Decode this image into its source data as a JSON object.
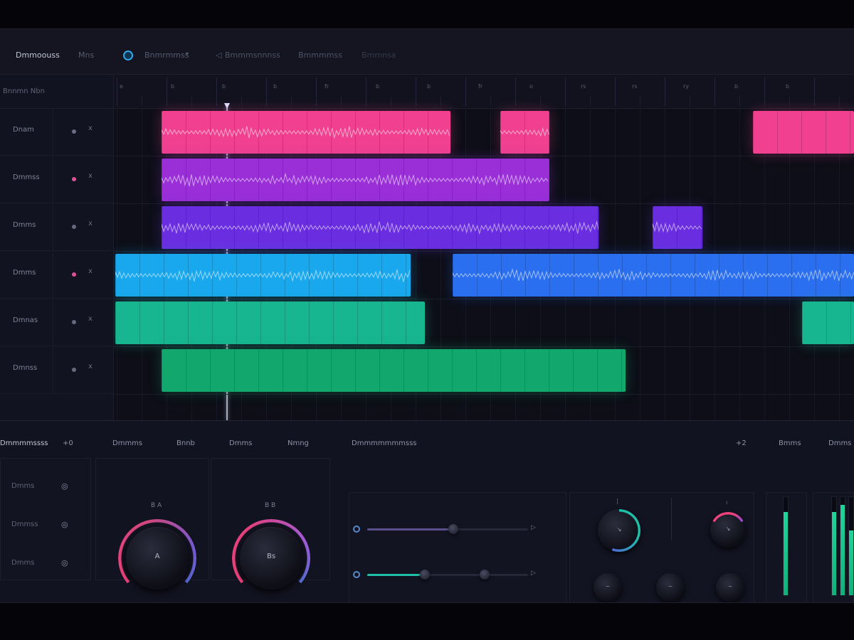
{
  "toolbar": {
    "title": "Dmmoouss",
    "menu_item": "Mns",
    "dropdown_label": "Bnmrmmss",
    "back_label": "Bmmmsnnnss",
    "item_3": "Bmmmmss",
    "item_4": "Bmmnsa"
  },
  "header": {
    "label": "Bnnmn Nbn"
  },
  "ruler_labels": [
    "e",
    "b",
    "b",
    "b",
    "fr",
    "b",
    "b",
    "fr",
    "o",
    "rs",
    "rs",
    "ry",
    "b",
    "b"
  ],
  "tracks": [
    {
      "name": "Dnam",
      "indicator": "#6b6e82",
      "mark": "x"
    },
    {
      "name": "Dmmss",
      "indicator": "#e0509a",
      "mark": "x"
    },
    {
      "name": "Dmms",
      "indicator": "#676a7e",
      "mark": "x"
    },
    {
      "name": "Dmms",
      "indicator": "#e0509a",
      "mark": "x"
    },
    {
      "name": "Dmnas",
      "indicator": "#676a7e",
      "mark": "x"
    },
    {
      "name": "Dmnss",
      "indicator": "#676a7e",
      "mark": "x"
    }
  ],
  "colors": {
    "pink": "#f0408f",
    "magenta": "#9a2fd8",
    "violet": "#6a2ee0",
    "cyan": "#19a8ee",
    "blue": "#2a6ff0",
    "indigo": "#3540e8",
    "teal": "#17b590",
    "green": "#12a86d",
    "accent_teal": "#1fbfa8",
    "accent_pink": "#f2437d"
  },
  "clips": [
    {
      "lane": 0,
      "color": "pink",
      "start": 0.064,
      "end": 0.455,
      "wave": true
    },
    {
      "lane": 0,
      "color": "pink",
      "start": 0.522,
      "end": 0.588,
      "wave": true
    },
    {
      "lane": 0,
      "color": "pink",
      "start": 0.863,
      "end": 1.0,
      "wave": false
    },
    {
      "lane": 1,
      "color": "magenta",
      "start": 0.064,
      "end": 0.588,
      "wave": true
    },
    {
      "lane": 2,
      "color": "violet",
      "start": 0.064,
      "end": 0.655,
      "wave": true
    },
    {
      "lane": 2,
      "color": "violet",
      "start": 0.728,
      "end": 0.795,
      "wave": true
    },
    {
      "lane": 3,
      "color": "cyan",
      "start": 0.002,
      "end": 0.401,
      "wave": true
    },
    {
      "lane": 3,
      "color": "blue",
      "start": 0.458,
      "end": 1.0,
      "wave": true
    },
    {
      "lane": 4,
      "color": "teal",
      "start": 0.002,
      "end": 0.42,
      "wave": false
    },
    {
      "lane": 4,
      "color": "teal",
      "start": 0.93,
      "end": 1.0,
      "wave": false
    },
    {
      "lane": 5,
      "color": "green",
      "start": 0.064,
      "end": 0.691,
      "wave": false
    }
  ],
  "bottom": {
    "section_title": "Dmmmmssss",
    "section_value": "+0",
    "tab_1": "Dmmms",
    "tab_2": "Bnnb",
    "tab_3": "Dmms",
    "tab_4": "Nmng",
    "rows": [
      {
        "label": "Dmms",
        "icon": "eye-icon"
      },
      {
        "label": "Dmmss",
        "icon": "eye-icon"
      },
      {
        "label": "Dmms",
        "icon": "eye-icon"
      }
    ],
    "knob_1": {
      "top": "B A",
      "label": "A"
    },
    "knob_2": {
      "top": "B B",
      "label": "Bs"
    },
    "eq_title": "Dmmmmmmmsss",
    "eq_value": "+2",
    "meter_1_label": "Bmms",
    "meter_2_label": "Dmms",
    "meter_levels": [
      0.85,
      0.85,
      0.92,
      0.66,
      0.92
    ]
  }
}
